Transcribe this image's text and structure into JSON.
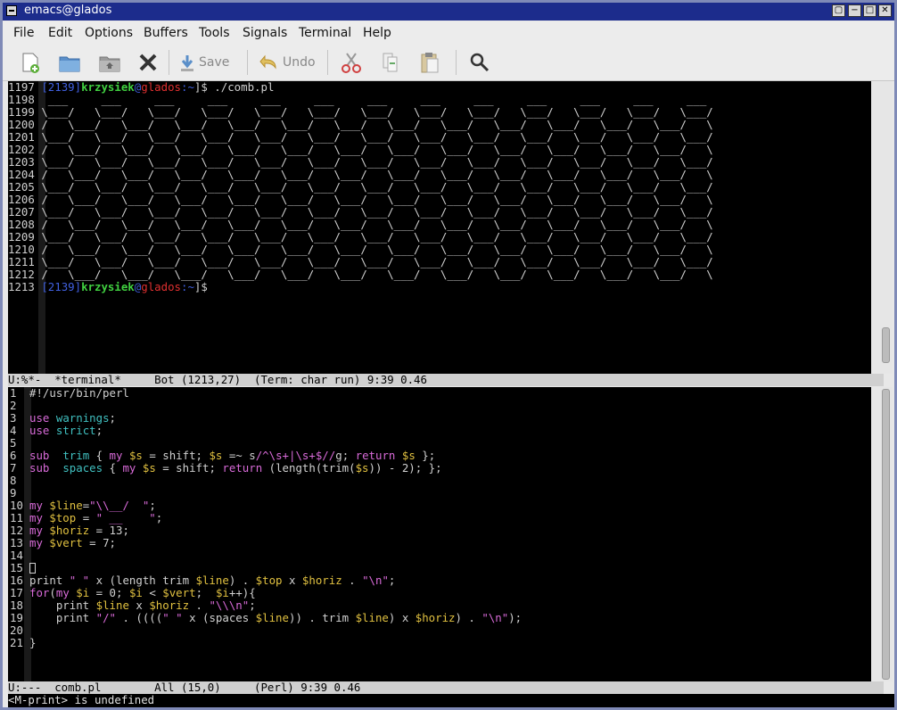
{
  "window": {
    "title": "emacs@glados",
    "controls": [
      "▢",
      "−",
      "□",
      "✕"
    ]
  },
  "menu": [
    "File",
    "Edit",
    "Options",
    "Buffers",
    "Tools",
    "Signals",
    "Terminal",
    "Help"
  ],
  "toolbar": {
    "save_label": "Save",
    "undo_label": "Undo"
  },
  "terminal": {
    "prompt_line_num": "1197",
    "prompt_pid": "[2139]",
    "prompt_user": "krzysiek",
    "prompt_at": "@",
    "prompt_host": "glados",
    "prompt_path": ":~",
    "prompt_suffix": "]$",
    "command": " ./comb.pl",
    "comb_lines": [
      {
        "n": "1198",
        "t": " ___     ___     ___     ___     ___     ___     ___     ___     ___     ___     ___     ___     ___"
      },
      {
        "n": "1199",
        "t": "\\___/   \\___/   \\___/   \\___/   \\___/   \\___/   \\___/   \\___/   \\___/   \\___/   \\___/   \\___/   \\___/"
      },
      {
        "n": "1200",
        "t": "/   \\___/   \\___/   \\___/   \\___/   \\___/   \\___/   \\___/   \\___/   \\___/   \\___/   \\___/   \\___/   \\"
      },
      {
        "n": "1201",
        "t": "\\___/   \\___/   \\___/   \\___/   \\___/   \\___/   \\___/   \\___/   \\___/   \\___/   \\___/   \\___/   \\___/"
      },
      {
        "n": "1202",
        "t": "/   \\___/   \\___/   \\___/   \\___/   \\___/   \\___/   \\___/   \\___/   \\___/   \\___/   \\___/   \\___/   \\"
      },
      {
        "n": "1203",
        "t": "\\___/   \\___/   \\___/   \\___/   \\___/   \\___/   \\___/   \\___/   \\___/   \\___/   \\___/   \\___/   \\___/"
      },
      {
        "n": "1204",
        "t": "/   \\___/   \\___/   \\___/   \\___/   \\___/   \\___/   \\___/   \\___/   \\___/   \\___/   \\___/   \\___/   \\"
      },
      {
        "n": "1205",
        "t": "\\___/   \\___/   \\___/   \\___/   \\___/   \\___/   \\___/   \\___/   \\___/   \\___/   \\___/   \\___/   \\___/"
      },
      {
        "n": "1206",
        "t": "/   \\___/   \\___/   \\___/   \\___/   \\___/   \\___/   \\___/   \\___/   \\___/   \\___/   \\___/   \\___/   \\"
      },
      {
        "n": "1207",
        "t": "\\___/   \\___/   \\___/   \\___/   \\___/   \\___/   \\___/   \\___/   \\___/   \\___/   \\___/   \\___/   \\___/"
      },
      {
        "n": "1208",
        "t": "/   \\___/   \\___/   \\___/   \\___/   \\___/   \\___/   \\___/   \\___/   \\___/   \\___/   \\___/   \\___/   \\"
      },
      {
        "n": "1209",
        "t": "\\___/   \\___/   \\___/   \\___/   \\___/   \\___/   \\___/   \\___/   \\___/   \\___/   \\___/   \\___/   \\___/"
      },
      {
        "n": "1210",
        "t": "/   \\___/   \\___/   \\___/   \\___/   \\___/   \\___/   \\___/   \\___/   \\___/   \\___/   \\___/   \\___/   \\"
      },
      {
        "n": "1211",
        "t": "\\___/   \\___/   \\___/   \\___/   \\___/   \\___/   \\___/   \\___/   \\___/   \\___/   \\___/   \\___/   \\___/"
      },
      {
        "n": "1212",
        "t": "/   \\___/   \\___/   \\___/   \\___/   \\___/   \\___/   \\___/   \\___/   \\___/   \\___/   \\___/   \\___/   \\"
      }
    ],
    "last_line_num": "1213",
    "modeline": "U:%*-  *terminal*     Bot (1213,27)  (Term: char run) 9:39 0.46"
  },
  "editor": {
    "line_numbers": [
      "1",
      "2",
      "3",
      "4",
      "5",
      "6",
      "7",
      "8",
      "9",
      "10",
      "11",
      "12",
      "13",
      "14",
      "15",
      "16",
      "17",
      "18",
      "19",
      "20",
      "21"
    ],
    "modeline": "U:---  comb.pl        All (15,0)     (Perl) 9:39 0.46"
  },
  "minibuffer": "<M-print> is undefined",
  "colors": {
    "title_bg": "#1c2c8c",
    "keyword": "#d86ad8",
    "builtin": "#40c0c0",
    "variable": "#e0c040",
    "prompt_user": "#40d040",
    "prompt_host": "#e03030",
    "prompt_pid": "#4060e0"
  }
}
